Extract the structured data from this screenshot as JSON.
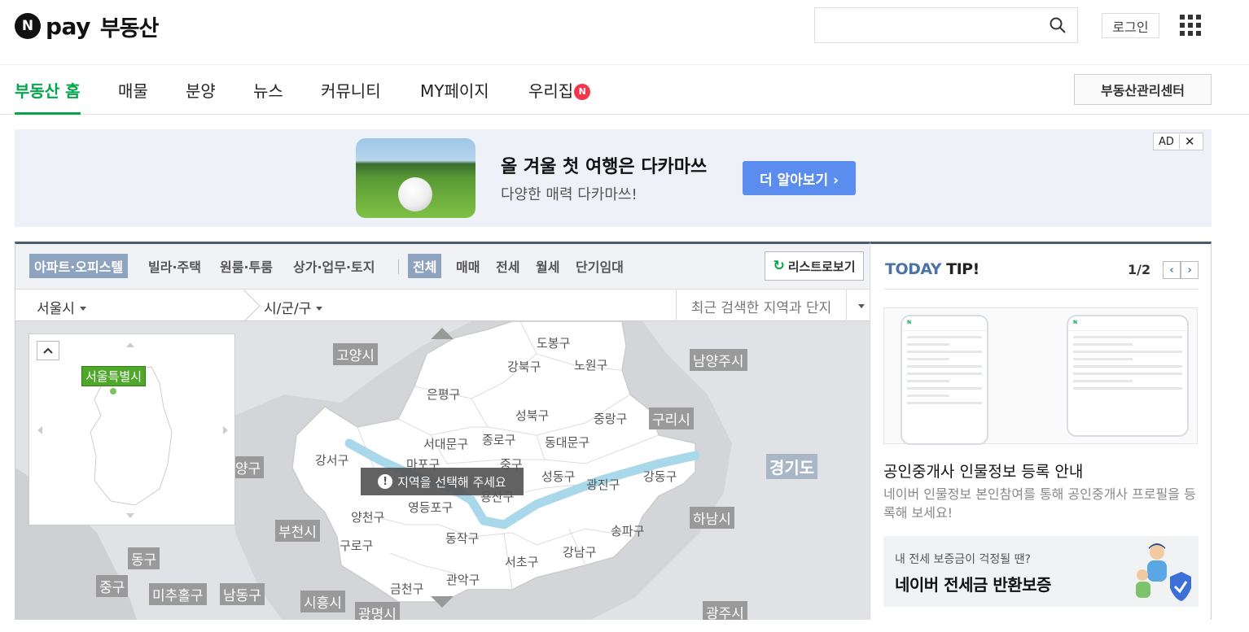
{
  "header": {
    "logo_n": "N",
    "logo_pay": "pay",
    "logo_service": "부동산",
    "login": "로그인"
  },
  "nav": {
    "items": [
      "부동산 홈",
      "매물",
      "분양",
      "뉴스",
      "커뮤니티",
      "MY페이지",
      "우리집"
    ],
    "badge": "N",
    "active_index": 0,
    "center_button": "부동산관리센터"
  },
  "ad": {
    "title": "올 겨울 첫 여행은 다카마쓰",
    "subtitle": "다양한 매력 다카마쓰!",
    "button": "더 알아보기 ›",
    "tag": "AD",
    "close": "✕"
  },
  "map": {
    "property_types": [
      "아파트·오피스텔",
      "빌라·주택",
      "원룸·투룸",
      "상가·업무·토지"
    ],
    "trade_types": [
      "전체",
      "매매",
      "전세",
      "월세",
      "단기임대"
    ],
    "list_view": "리스트로보기",
    "city": "서울시",
    "district": "시/군/구",
    "recent_search": "최근 검색한 지역과 단지",
    "select_message": "지역을 선택해 주세요",
    "minimap_label": "서울특별시",
    "districts": [
      "도봉구",
      "강북구",
      "노원구",
      "은평구",
      "성북구",
      "중랑구",
      "서대문구",
      "종로구",
      "동대문구",
      "강서구",
      "마포구",
      "중구",
      "성동구",
      "광진구",
      "강동구",
      "용산구",
      "양천구",
      "영등포구",
      "동작구",
      "구로구",
      "서초구",
      "강남구",
      "송파구",
      "관악구",
      "금천구"
    ],
    "outer_regions": [
      "고양시",
      "남양주시",
      "구리시",
      "경기도",
      "하남시",
      "부천시",
      "동구",
      "중구",
      "미추홀구",
      "남동구",
      "시흥시",
      "광명시",
      "광주시",
      "양구"
    ]
  },
  "tip": {
    "title_a": "TODAY",
    "title_b": "TIP!",
    "page": "1/2",
    "heading": "공인중개사 인물정보 등록 안내",
    "description": "네이버 인물정보 본인참여를 통해 공인중개사 프로필을 등록해 보세요!",
    "banner_sub": "내 전세 보증금이 걱정될 땐?",
    "banner_main": "네이버 전세금 반환보증"
  },
  "colors": {
    "brand_green": "#03a64a",
    "ad_button": "#5b8def",
    "map_header_border": "#4c5a6e",
    "selected_filter": "#8ea3be",
    "river": "#a8d8ea"
  }
}
